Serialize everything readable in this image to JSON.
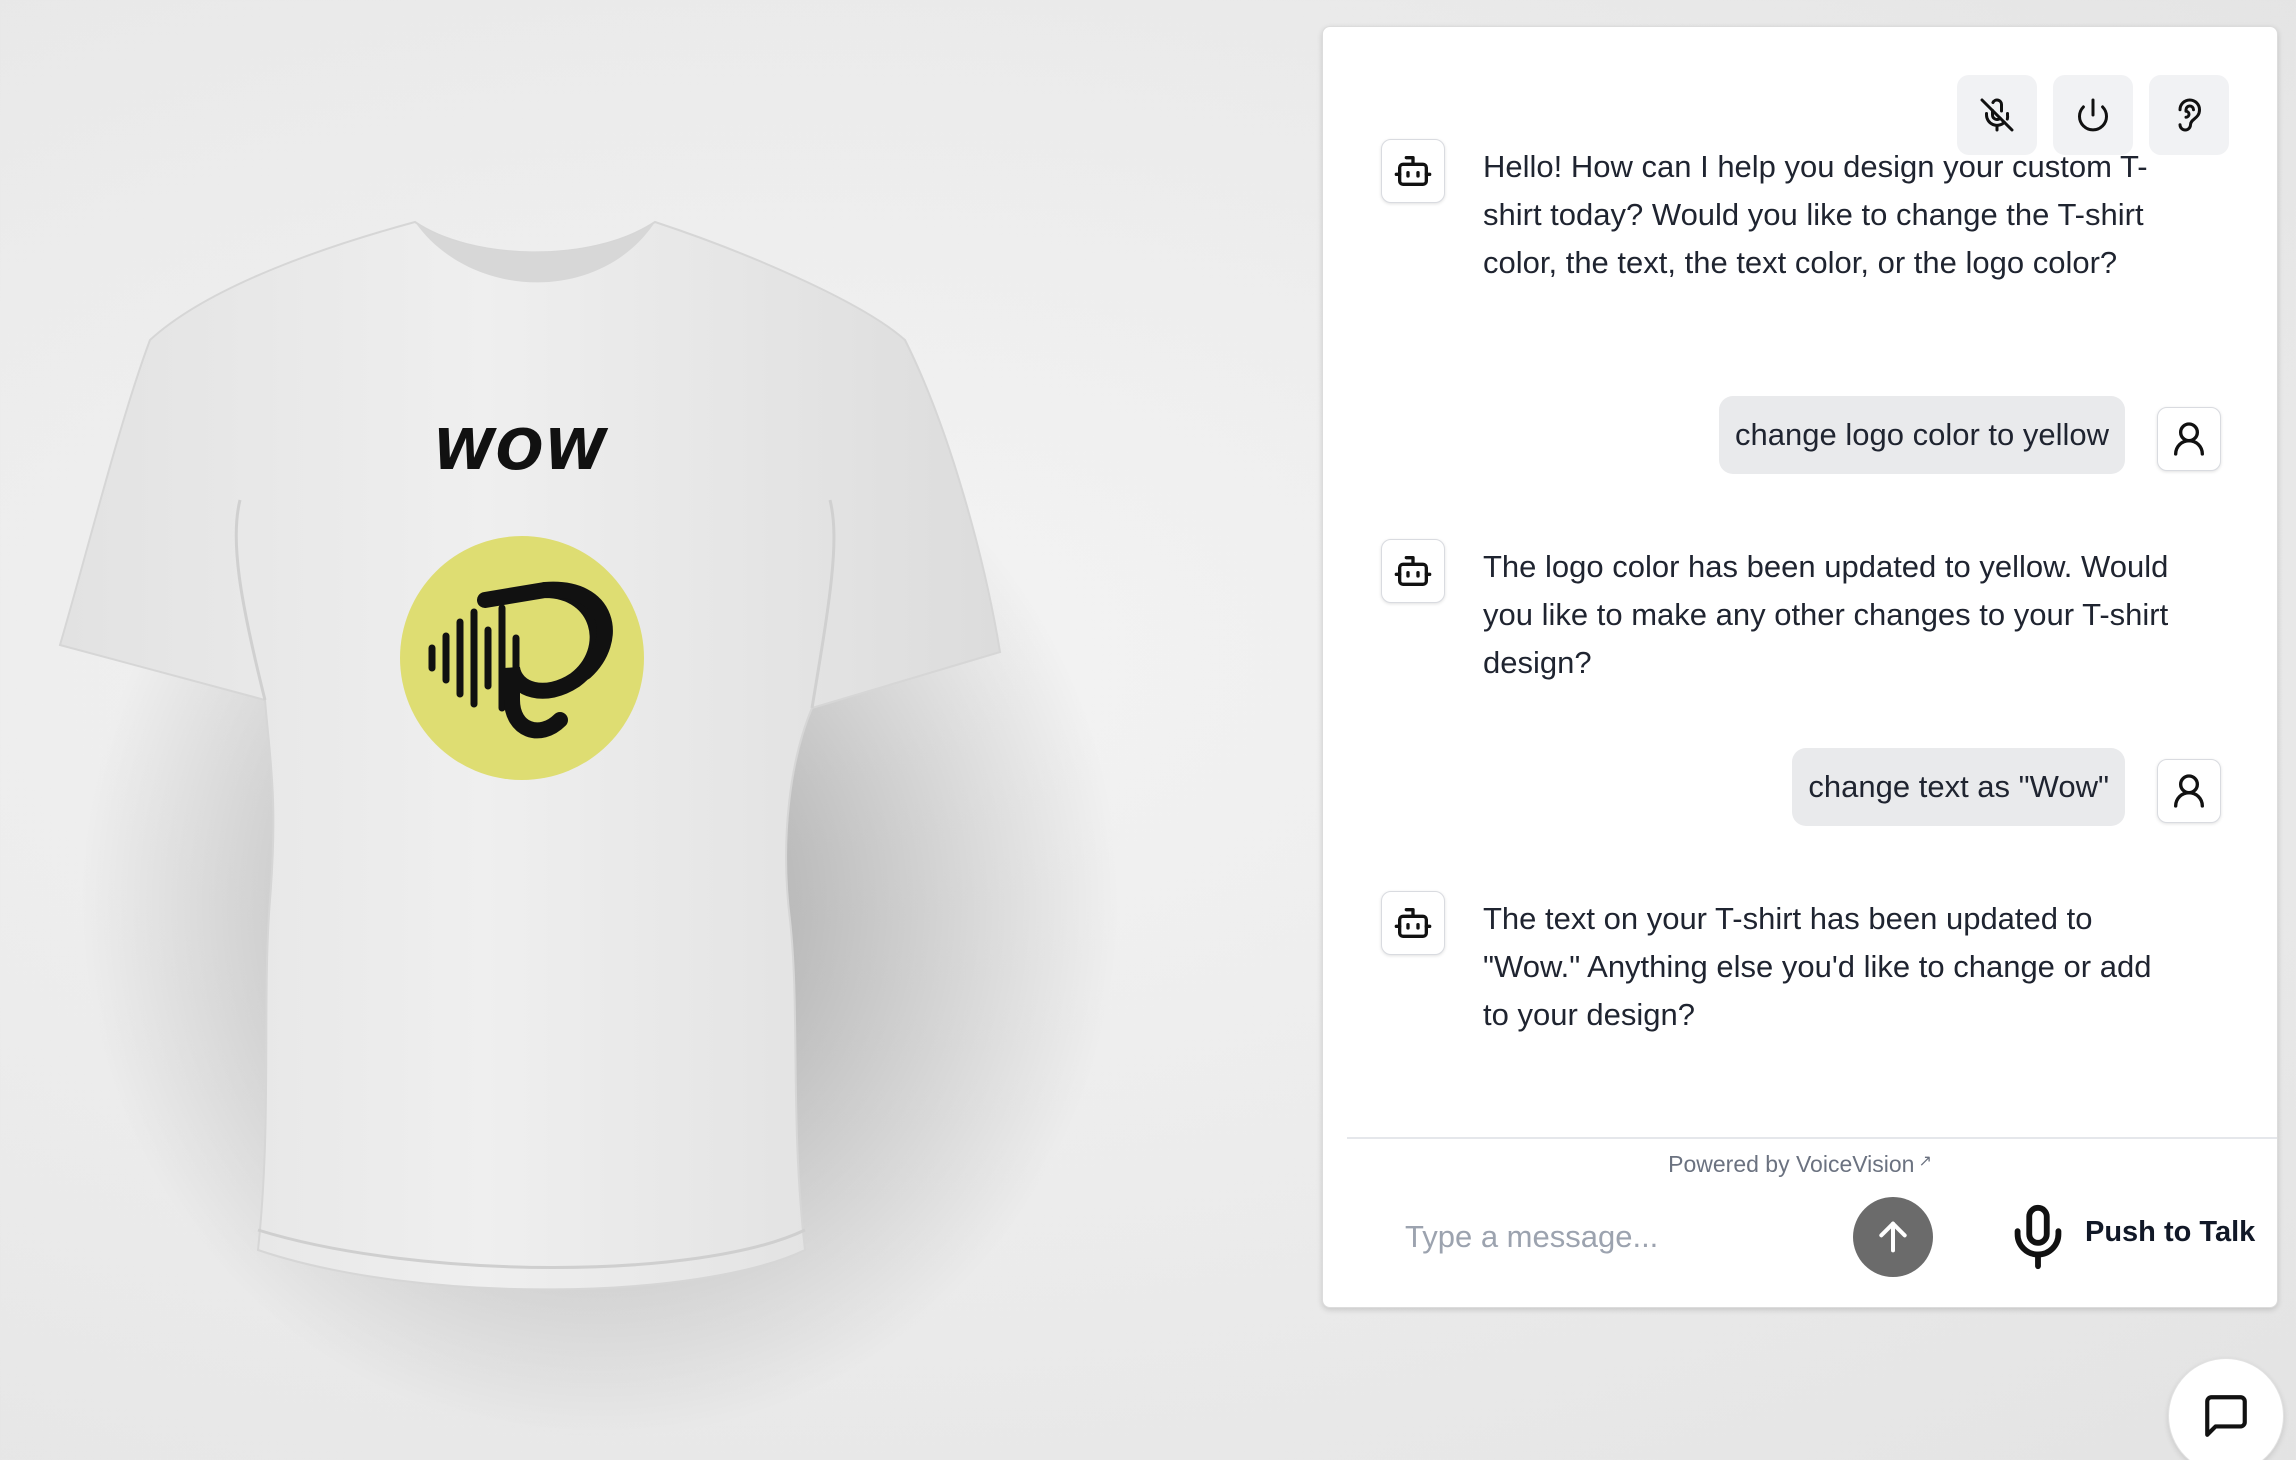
{
  "preview": {
    "shirt_color": "#e9e9e9",
    "shirt_text": "WOW",
    "logo_color": "#dedd72",
    "logo_icon": "voicevision-logo-icon"
  },
  "chat": {
    "toolbar": {
      "mute_icon": "mic-off-icon",
      "power_icon": "power-icon",
      "listen_icon": "ear-icon"
    },
    "messages": [
      {
        "role": "bot",
        "text": "Hello! How can I help you design your custom T-shirt today? Would you like to change the T-shirt color, the text, the text color, or the logo color?"
      },
      {
        "role": "user",
        "text": "change logo color to yellow"
      },
      {
        "role": "bot",
        "text": "The logo color has been updated to yellow. Would you like to make any other changes to your T-shirt design?"
      },
      {
        "role": "user",
        "text": "change text as \"Wow\""
      },
      {
        "role": "bot",
        "text": "The text on your T-shirt has been updated to \"Wow.\" Anything else you'd like to change or add to your design?"
      }
    ],
    "powered_by": "Powered by VoiceVision",
    "powered_by_link_icon": "↗",
    "input_placeholder": "Type a message...",
    "push_to_talk_label": "Push to Talk"
  },
  "colors": {
    "send_button": "#6b6b6b",
    "bubble_user": "#e9eaec"
  }
}
